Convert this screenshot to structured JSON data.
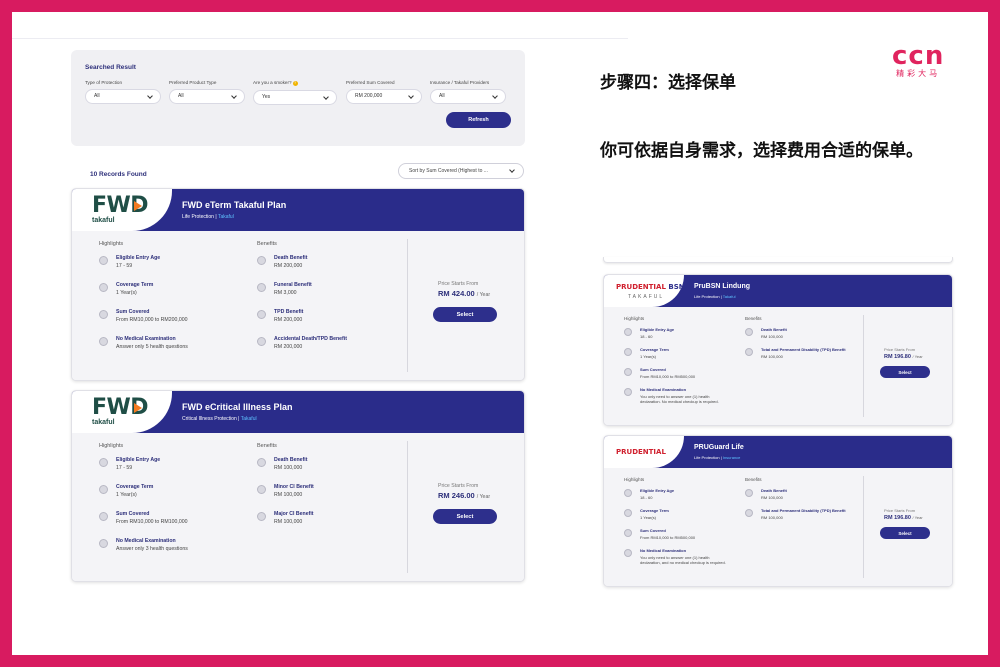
{
  "search": {
    "title": "Searched Result",
    "filters": [
      {
        "label": "Type of Protection",
        "value": "All"
      },
      {
        "label": "Preferred Product Type",
        "value": "All"
      },
      {
        "label": "Are you a smoker?",
        "value": "Yes"
      },
      {
        "label": "Preferred Sum Covered",
        "value": "RM 200,000"
      },
      {
        "label": "Insurance / Takaful Providers",
        "value": "All"
      }
    ],
    "refresh_label": "Refresh"
  },
  "records_found": "10 Records Found",
  "sort_value": "Sort by Sum Covered (Highest to ...",
  "labels": {
    "highlights": "Highlights",
    "benefits": "Benefits",
    "price_starts": "Price Starts From",
    "per_year": "/ Year",
    "select": "Select"
  },
  "plans_main": [
    {
      "logo": "FWD",
      "logo_sub": "takaful",
      "name": "FWD eTerm Takaful Plan",
      "category": "Life Protection",
      "tag": "Takaful",
      "highlights": [
        {
          "title": "Eligible Entry Age",
          "value": "17 - 59"
        },
        {
          "title": "Coverage Term",
          "value": "1 Year(s)"
        },
        {
          "title": "Sum Covered",
          "value": "From RM10,000 to RM200,000"
        },
        {
          "title": "No Medical Examination",
          "value": "Answer only 5 health questions"
        }
      ],
      "benefits": [
        {
          "title": "Death Benefit",
          "value": "RM 200,000"
        },
        {
          "title": "Funeral Benefit",
          "value": "RM 3,000"
        },
        {
          "title": "TPD Benefit",
          "value": "RM 200,000"
        },
        {
          "title": "Accidental Death/TPD Benefit",
          "value": "RM 200,000"
        }
      ],
      "price": "RM 424.00"
    },
    {
      "logo": "FWD",
      "logo_sub": "takaful",
      "name": "FWD eCritical Illness Plan",
      "category": "Critical Illness Protection",
      "tag": "Takaful",
      "highlights": [
        {
          "title": "Eligible Entry Age",
          "value": "17 - 59"
        },
        {
          "title": "Coverage Term",
          "value": "1 Year(s)"
        },
        {
          "title": "Sum Covered",
          "value": "From RM10,000 to RM100,000"
        },
        {
          "title": "No Medical Examination",
          "value": "Answer only 3 health questions"
        }
      ],
      "benefits": [
        {
          "title": "Death Benefit",
          "value": "RM 100,000"
        },
        {
          "title": "Minor CI Benefit",
          "value": "RM 100,000"
        },
        {
          "title": "Major CI Benefit",
          "value": "RM 100,000"
        }
      ],
      "price": "RM 246.00"
    }
  ],
  "plans_side": [
    {
      "logo_a": "PRUDENTIAL",
      "logo_b": "BSN",
      "logo_sub": "TAKAFUL",
      "name": "PruBSN Lindung",
      "category": "Life Protection",
      "tag": "Takaful",
      "highlights": [
        {
          "title": "Eligible Entry Age",
          "value": "18 - 60"
        },
        {
          "title": "Coverage Term",
          "value": "1 Year(s)"
        },
        {
          "title": "Sum Covered",
          "value": "From RM10,000 to RM500,000"
        },
        {
          "title": "No Medical Examination",
          "value": "You only need to answer one (1) health",
          "value2": "declaration. No medical checkup is required."
        }
      ],
      "benefits": [
        {
          "title": "Death Benefit",
          "value": "RM 100,000"
        },
        {
          "title": "Total and Permanent Disability (TPD) Benefit",
          "value": "RM 100,000"
        }
      ],
      "price": "RM 196.80"
    },
    {
      "logo_a": "PRUDENTIAL",
      "logo_b": "",
      "name": "PRUGuard Life",
      "category": "Life Protection",
      "tag": "Insurance",
      "highlights": [
        {
          "title": "Eligible Entry Age",
          "value": "18 - 60"
        },
        {
          "title": "Coverage Term",
          "value": "1 Year(s)"
        },
        {
          "title": "Sum Covered",
          "value": "From RM10,000 to RM500,000"
        },
        {
          "title": "No Medical Examination",
          "value": "You only need to answer one (1) health",
          "value2": "declaration, and no medical checkup is required."
        }
      ],
      "benefits": [
        {
          "title": "Death Benefit",
          "value": "RM 100,000"
        },
        {
          "title": "Total and Permanent Disability (TPD) Benefit",
          "value": "RM 100,000"
        }
      ],
      "price": "RM 196.80"
    }
  ],
  "slide": {
    "step": "步骤四：选择保单",
    "desc": "你可依据自身需求，选择费用合适的保单。",
    "brand": "ccn",
    "brand_sub": "精彩大马"
  },
  "colors": {
    "border": "#d81b60",
    "brand": "#2a2c8a",
    "accent": "#e0245e"
  }
}
